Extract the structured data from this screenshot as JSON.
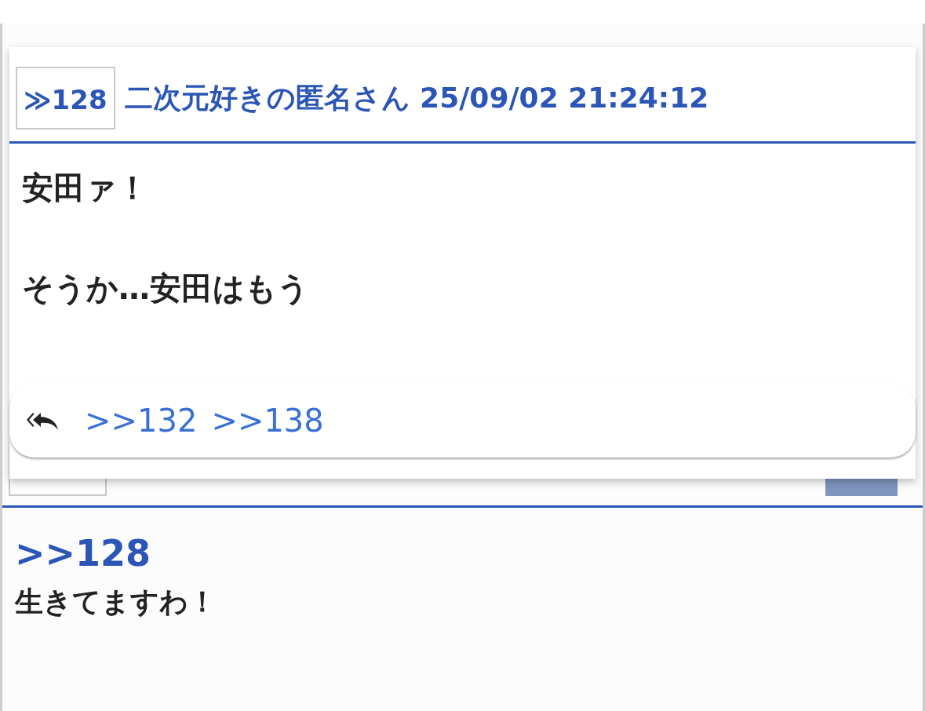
{
  "thread": {
    "post": {
      "quote": ">>128",
      "lines": [
        "生きてますわ！"
      ]
    }
  },
  "popup": {
    "number": "≫128",
    "author": "二次元好きの匿名さん",
    "date": "25/09/02 21:24:12",
    "paragraphs": [
      "安田ァ！",
      "そうか…安田はもう"
    ],
    "replies": [
      ">>132",
      ">>138"
    ]
  }
}
